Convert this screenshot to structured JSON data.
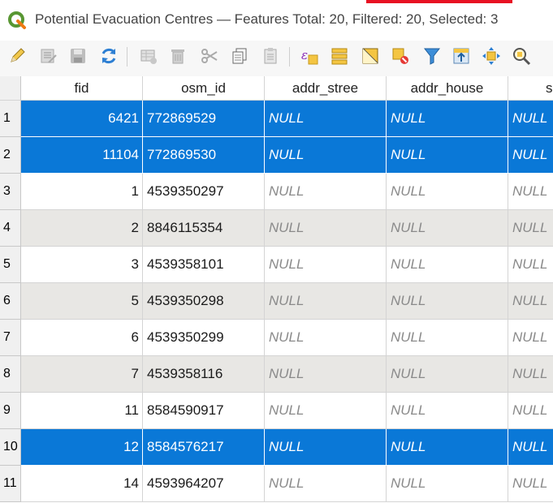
{
  "window": {
    "title": "Potential Evacuation Centres — Features Total: 20, Filtered: 20, Selected: 3",
    "accent_color": "#0a78d7",
    "close_strip_color": "#e81123"
  },
  "toolbar": {
    "icons": [
      "toggle-editing-icon",
      "multi-edit-icon",
      "save-edits-icon",
      "reload-icon",
      "add-feature-icon",
      "delete-feature-icon",
      "cut-icon",
      "copy-icon",
      "paste-icon",
      "expression-select-icon",
      "select-all-icon",
      "invert-selection-icon",
      "deselect-all-icon",
      "filter-icon",
      "move-selection-top-icon",
      "pan-to-selection-icon",
      "zoom-to-selection-icon"
    ]
  },
  "table": {
    "columns": [
      "fid",
      "osm_id",
      "addr_stree",
      "addr_house",
      "s"
    ],
    "null_text": "NULL",
    "rows": [
      {
        "num": "1",
        "fid": "6421",
        "osm_id": "772869529",
        "selected": true
      },
      {
        "num": "2",
        "fid": "11104",
        "osm_id": "772869530",
        "selected": true
      },
      {
        "num": "3",
        "fid": "1",
        "osm_id": "4539350297",
        "selected": false
      },
      {
        "num": "4",
        "fid": "2",
        "osm_id": "8846115354",
        "selected": false
      },
      {
        "num": "5",
        "fid": "3",
        "osm_id": "4539358101",
        "selected": false
      },
      {
        "num": "6",
        "fid": "5",
        "osm_id": "4539350298",
        "selected": false
      },
      {
        "num": "7",
        "fid": "6",
        "osm_id": "4539350299",
        "selected": false
      },
      {
        "num": "8",
        "fid": "7",
        "osm_id": "4539358116",
        "selected": false
      },
      {
        "num": "9",
        "fid": "11",
        "osm_id": "8584590917",
        "selected": false
      },
      {
        "num": "10",
        "fid": "12",
        "osm_id": "8584576217",
        "selected": true
      },
      {
        "num": "11",
        "fid": "14",
        "osm_id": "4593964207",
        "selected": false
      }
    ]
  }
}
